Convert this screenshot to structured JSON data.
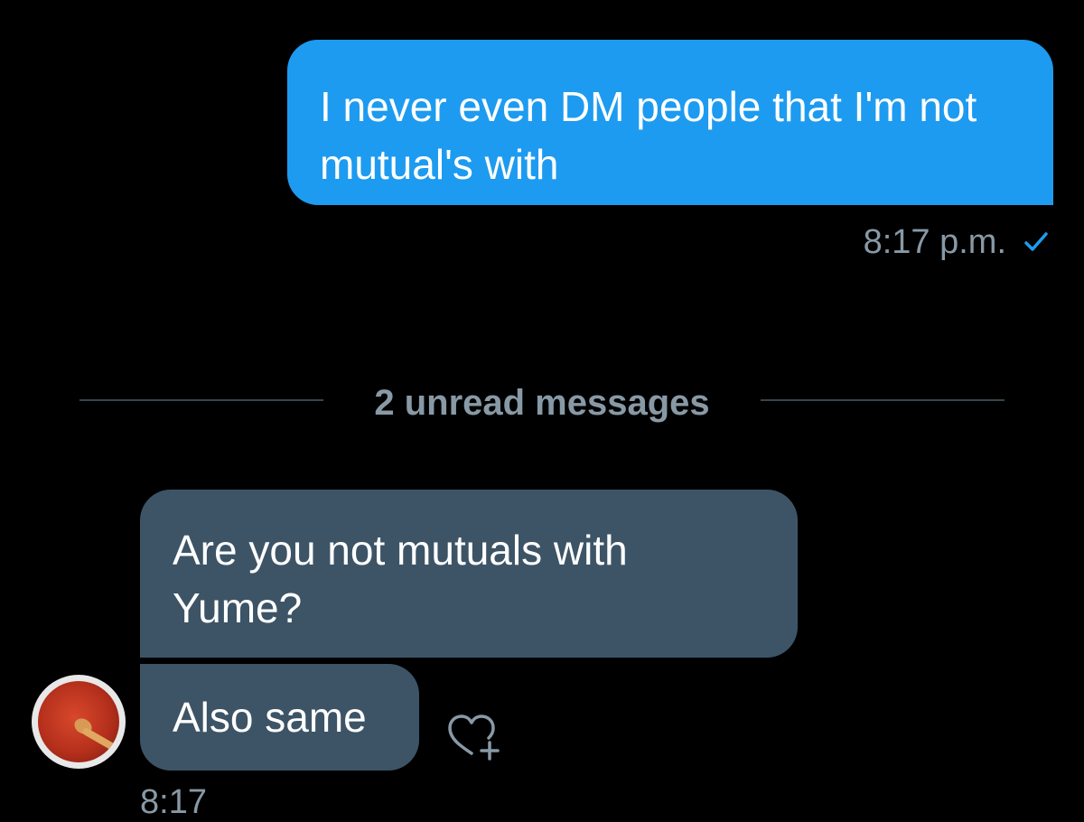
{
  "messages": {
    "sent": {
      "text": "I never even DM people that I'm not mutual's with",
      "time": "8:17 p.m.",
      "status_icon": "check-icon"
    },
    "divider_label": "2 unread messages",
    "received": [
      {
        "text": "Are you not mutuals with Yume?"
      },
      {
        "text": "Also same"
      }
    ],
    "received_time_partial": "8:17",
    "reaction_icon": "heart-plus-icon",
    "avatar": "avatar-tomato-sauce"
  },
  "colors": {
    "sent_bubble": "#1d9bf0",
    "received_bubble": "#3d5466",
    "meta_text": "#8899a6",
    "background": "#000000"
  }
}
